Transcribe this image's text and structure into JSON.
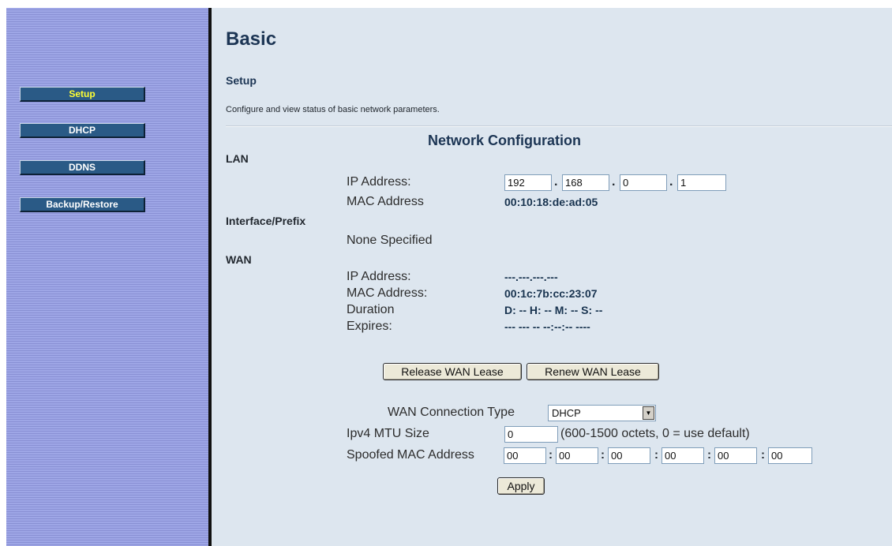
{
  "nav": {
    "items": [
      {
        "label": "Setup",
        "active": true
      },
      {
        "label": "DHCP",
        "active": false
      },
      {
        "label": "DDNS",
        "active": false
      },
      {
        "label": "Backup/Restore",
        "active": false
      }
    ]
  },
  "page": {
    "title": "Basic",
    "subtitle": "Setup",
    "description": "Configure and view status of basic network parameters.",
    "section_title": "Network Configuration"
  },
  "lan": {
    "heading": "LAN",
    "ip_label": "IP Address:",
    "ip_octets": [
      "192",
      "168",
      "0",
      "1"
    ],
    "mac_label": "MAC Address",
    "mac_value": "00:10:18:de:ad:05"
  },
  "interface": {
    "heading": "Interface/Prefix",
    "value": "None Specified"
  },
  "wan": {
    "heading": "WAN",
    "ip_label": "IP Address:",
    "ip_value": "---.---.---.---",
    "mac_label": "MAC Address:",
    "mac_value": "00:1c:7b:cc:23:07",
    "duration_label": "Duration",
    "duration_value": "D: -- H: -- M: -- S: --",
    "expires_label": "Expires:",
    "expires_value": "--- --- -- --:--:-- ----",
    "release_label": "Release WAN Lease",
    "renew_label": "Renew WAN Lease"
  },
  "settings": {
    "conn_type_label": "WAN Connection Type",
    "conn_type_value": "DHCP",
    "mtu_label": "Ipv4 MTU Size",
    "mtu_value": "0",
    "mtu_hint": "(600-1500 octets, 0 = use default)",
    "spoof_label": "Spoofed MAC Address",
    "spoof_octets": [
      "00",
      "00",
      "00",
      "00",
      "00",
      "00"
    ],
    "apply_label": "Apply"
  },
  "icons": {
    "select_arrow": "chevron-down-icon"
  }
}
